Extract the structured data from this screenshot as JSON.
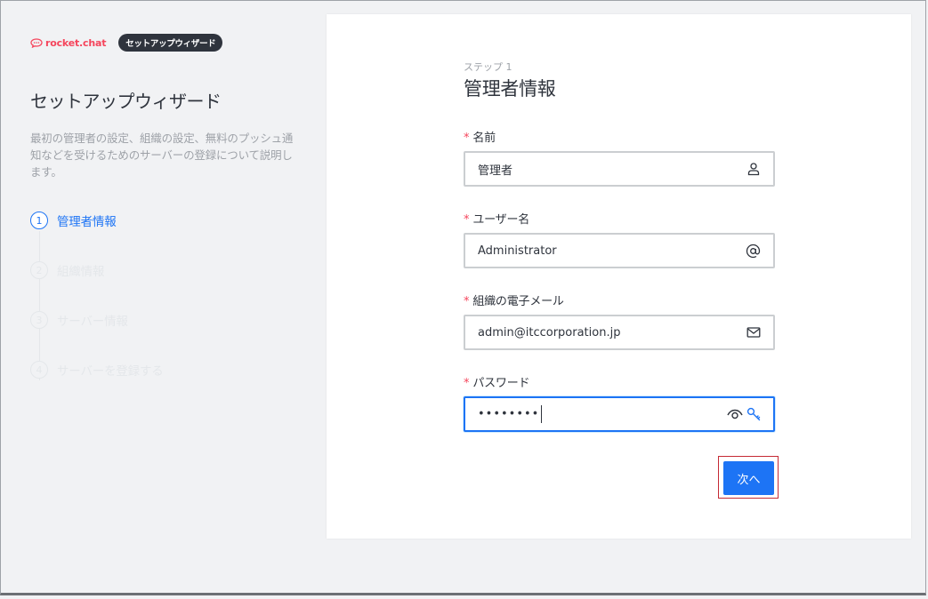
{
  "brand": {
    "logo_text": "rocket.chat",
    "badge": "セットアップウィザード"
  },
  "wizard": {
    "title": "セットアップウィザード",
    "description": "最初の管理者の設定、組織の設定、無料のプッシュ通知などを受けるためのサーバーの登録について説明します。",
    "steps": [
      {
        "number": "1",
        "label": "管理者情報",
        "active": true
      },
      {
        "number": "2",
        "label": "組織情報",
        "active": false
      },
      {
        "number": "3",
        "label": "サーバー情報",
        "active": false
      },
      {
        "number": "4",
        "label": "サーバーを登録する",
        "active": false
      }
    ]
  },
  "form": {
    "step_label": "ステップ 1",
    "title": "管理者情報",
    "fields": {
      "name": {
        "label": "名前",
        "value": "管理者",
        "icon": "user-icon"
      },
      "username": {
        "label": "ユーザー名",
        "value": "Administrator",
        "icon": "at-icon"
      },
      "email": {
        "label": "組織の電子メール",
        "value": "admin@itccorporation.jp",
        "icon": "mail-icon"
      },
      "password": {
        "label": "パスワード",
        "value": "••••••••",
        "icons": [
          "eye-icon",
          "key-icon"
        ]
      }
    },
    "required_mark": "*",
    "next_label": "次へ"
  },
  "colors": {
    "accent": "#1d74f5",
    "required": "#f5455c",
    "brand": "#f5455c"
  }
}
